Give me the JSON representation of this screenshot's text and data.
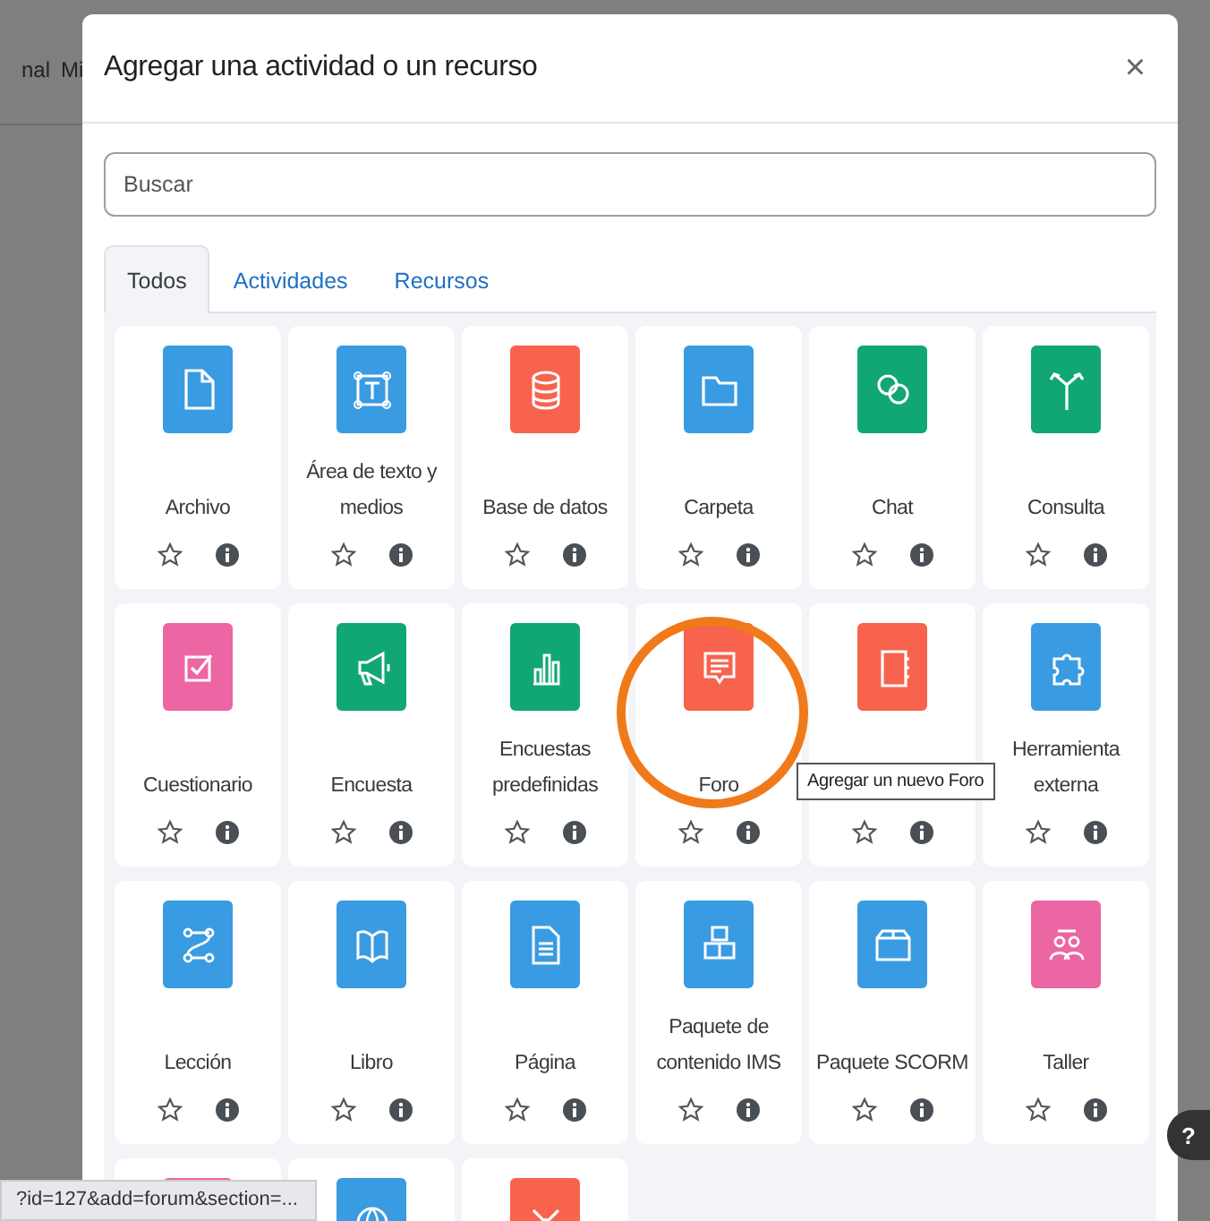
{
  "background_nav": [
    "nal",
    "Mi"
  ],
  "modal": {
    "title": "Agregar una actividad o un recurso",
    "close": "×",
    "search": {
      "placeholder": "Buscar"
    },
    "tabs": [
      {
        "label": "Todos",
        "selected": true
      },
      {
        "label": "Actividades",
        "selected": false
      },
      {
        "label": "Recursos",
        "selected": false
      }
    ],
    "items": [
      {
        "label": "Archivo",
        "kind": "file",
        "color": "#399be2"
      },
      {
        "label": "Área de texto y medios",
        "kind": "textarea",
        "color": "#399be2"
      },
      {
        "label": "Base de datos",
        "kind": "database",
        "color": "#f7634d"
      },
      {
        "label": "Carpeta",
        "kind": "folder",
        "color": "#399be2"
      },
      {
        "label": "Chat",
        "kind": "chat",
        "color": "#11a676"
      },
      {
        "label": "Consulta",
        "kind": "choice",
        "color": "#11a676"
      },
      {
        "label": "Cuestionario",
        "kind": "quiz",
        "color": "#eb66a2"
      },
      {
        "label": "Encuesta",
        "kind": "survey",
        "color": "#11a676"
      },
      {
        "label": "Encuestas predefinidas",
        "kind": "chart",
        "color": "#11a676"
      },
      {
        "label": "Foro",
        "kind": "forum",
        "color": "#f7634d",
        "highlighted": true,
        "tooltip": "Agregar un nuevo Foro"
      },
      {
        "kind": "notebook",
        "color": "#f7634d"
      },
      {
        "label": "Herramienta externa",
        "kind": "puzzle",
        "color": "#399be2"
      },
      {
        "label": "Lección",
        "kind": "lesson",
        "color": "#399be2"
      },
      {
        "label": "Libro",
        "kind": "book",
        "color": "#399be2"
      },
      {
        "label": "Página",
        "kind": "page",
        "color": "#399be2"
      },
      {
        "label": "Paquete de contenido IMS",
        "kind": "blocks",
        "color": "#399be2"
      },
      {
        "label": "Paquete SCORM",
        "kind": "box",
        "color": "#399be2"
      },
      {
        "label": "Taller",
        "kind": "people",
        "color": "#eb66a2"
      },
      {
        "kind": "blank",
        "color": "#eb66a2"
      },
      {
        "kind": "globe",
        "color": "#399be2"
      },
      {
        "kind": "network",
        "color": "#f7634d"
      }
    ]
  },
  "status_bar": "?id=127&add=forum&section=...",
  "help_button": "?"
}
